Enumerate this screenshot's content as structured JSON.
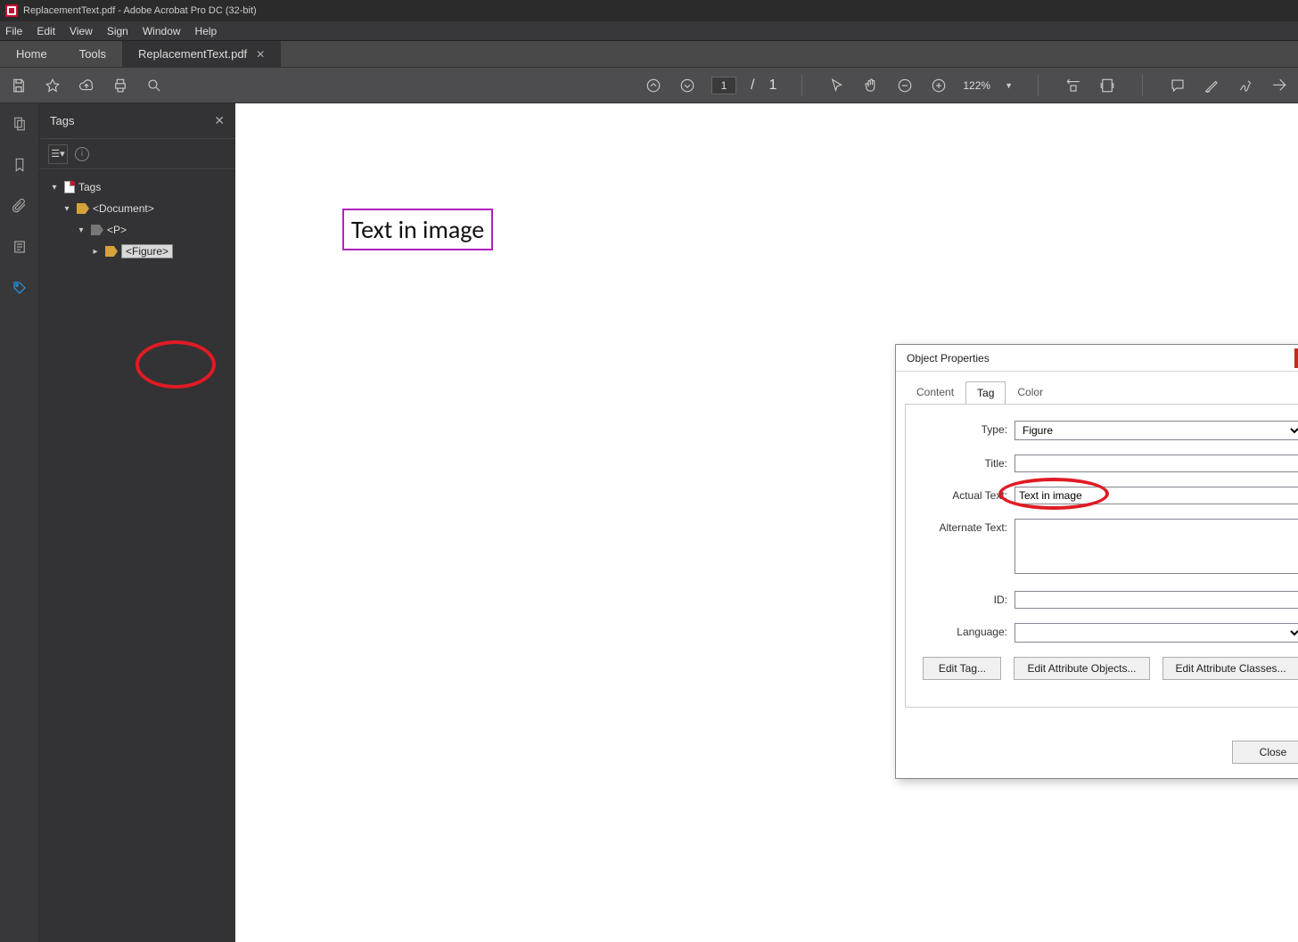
{
  "titlebar": {
    "text": "ReplacementText.pdf - Adobe Acrobat Pro DC (32-bit)"
  },
  "menubar": {
    "items": [
      "File",
      "Edit",
      "View",
      "Sign",
      "Window",
      "Help"
    ]
  },
  "tabs": {
    "home": "Home",
    "tools": "Tools",
    "doc": "ReplacementText.pdf"
  },
  "toolbar": {
    "page_current": "1",
    "page_sep": "/",
    "page_total": "1",
    "zoom": "122%"
  },
  "sidepanel": {
    "title": "Tags"
  },
  "tree": {
    "root": "Tags",
    "doc": "<Document>",
    "p": "<P>",
    "figure": "<Figure>"
  },
  "document": {
    "figure_text": "Text in image"
  },
  "dialog": {
    "title": "Object Properties",
    "tabs": {
      "content": "Content",
      "tag": "Tag",
      "color": "Color"
    },
    "labels": {
      "type": "Type:",
      "title": "Title:",
      "actual": "Actual Text:",
      "alt": "Alternate Text:",
      "id": "ID:",
      "lang": "Language:"
    },
    "values": {
      "type": "Figure",
      "title": "",
      "actual": "Text in image",
      "alt": "",
      "id": "",
      "lang": ""
    },
    "buttons": {
      "edit_tag": "Edit Tag...",
      "edit_attr_obj": "Edit Attribute Objects...",
      "edit_attr_cls": "Edit Attribute Classes...",
      "close": "Close"
    }
  }
}
